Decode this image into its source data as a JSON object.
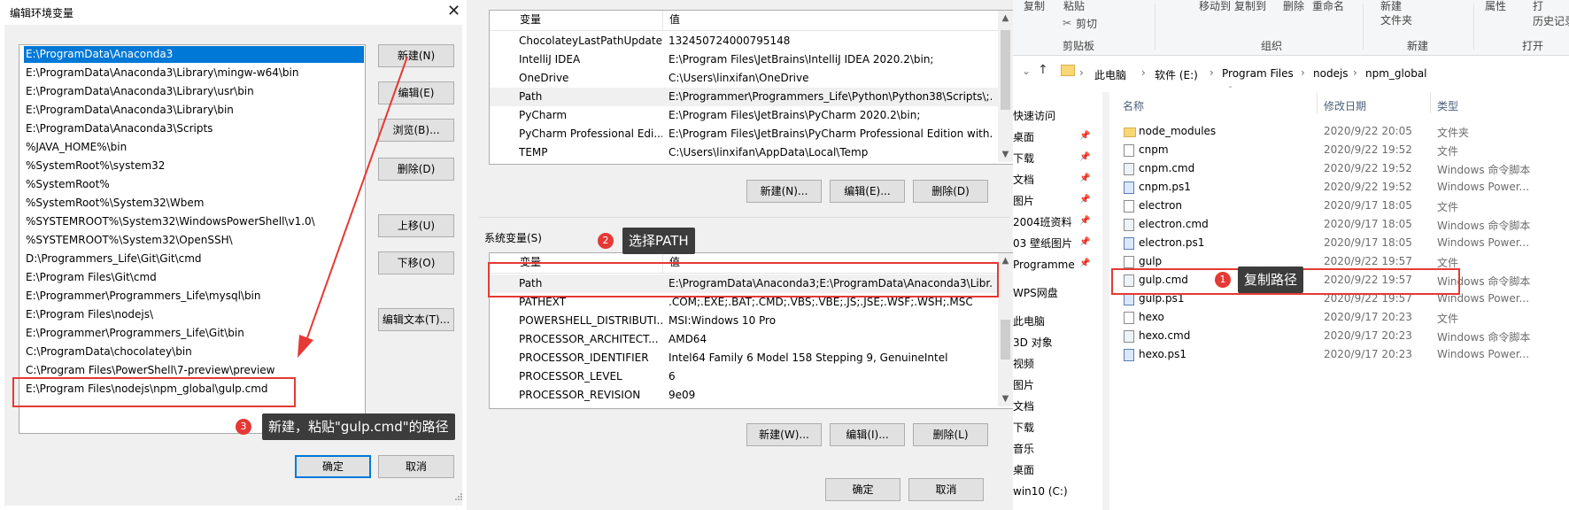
{
  "edit_dialog": {
    "title": "编辑环境变量",
    "close_glyph": "✕",
    "entries": [
      "E:\\ProgramData\\Anaconda3",
      "E:\\ProgramData\\Anaconda3\\Library\\mingw-w64\\bin",
      "E:\\ProgramData\\Anaconda3\\Library\\usr\\bin",
      "E:\\ProgramData\\Anaconda3\\Library\\bin",
      "E:\\ProgramData\\Anaconda3\\Scripts",
      "%JAVA_HOME%\\bin",
      "%SystemRoot%\\system32",
      "%SystemRoot%",
      "%SystemRoot%\\System32\\Wbem",
      "%SYSTEMROOT%\\System32\\WindowsPowerShell\\v1.0\\",
      "%SYSTEMROOT%\\System32\\OpenSSH\\",
      "D:\\Programmers_Life\\Git\\Git\\cmd",
      "E:\\Program Files\\Git\\cmd",
      "E:\\Programmer\\Programmers_Life\\mysql\\bin",
      "E:\\Program Files\\nodejs\\",
      "E:\\Programmer\\Programmers_Life\\Git\\bin",
      "C:\\ProgramData\\chocolatey\\bin",
      "C:\\Program Files\\PowerShell\\7-preview\\preview",
      "E:\\Program Files\\nodejs\\npm_global\\gulp.cmd"
    ],
    "buttons": {
      "new": "新建(N)",
      "edit": "编辑(E)",
      "browse": "浏览(B)...",
      "delete": "删除(D)",
      "move_up": "上移(U)",
      "move_down": "下移(O)",
      "edit_text": "编辑文本(T)...",
      "ok": "确定",
      "cancel": "取消"
    },
    "callout": {
      "number": "3",
      "text": "新建，粘贴\"gulp.cmd\"的路径"
    }
  },
  "env_dialog": {
    "user_vars": {
      "headers": {
        "name": "变量",
        "value": "值"
      },
      "rows": [
        {
          "name": "ChocolateyLastPathUpdate",
          "value": "132450724000795148"
        },
        {
          "name": "IntelliJ IDEA",
          "value": "E:\\Program Files\\JetBrains\\IntelliJ IDEA 2020.2\\bin;"
        },
        {
          "name": "OneDrive",
          "value": "C:\\Users\\linxifan\\OneDrive"
        },
        {
          "name": "Path",
          "value": "E:\\Programmer\\Programmers_Life\\Python\\Python38\\Scripts\\;..."
        },
        {
          "name": "PyCharm",
          "value": "E:\\Program Files\\JetBrains\\PyCharm 2020.2\\bin;"
        },
        {
          "name": "PyCharm Professional Edi...",
          "value": "E:\\Program Files\\JetBrains\\PyCharm Professional Edition with..."
        },
        {
          "name": "TEMP",
          "value": "C:\\Users\\linxifan\\AppData\\Local\\Temp"
        }
      ],
      "buttons": {
        "new": "新建(N)...",
        "edit": "编辑(E)...",
        "delete": "删除(D)"
      }
    },
    "system_label": "系统变量(S)",
    "system_vars": {
      "headers": {
        "name": "变量",
        "value": "值"
      },
      "rows": [
        {
          "name": "Path",
          "value": "E:\\ProgramData\\Anaconda3;E:\\ProgramData\\Anaconda3\\Libr..."
        },
        {
          "name": "PATHEXT",
          "value": ".COM;.EXE;.BAT;.CMD;.VBS;.VBE;.JS;.JSE;.WSF;.WSH;.MSC"
        },
        {
          "name": "POWERSHELL_DISTRIBUTI...",
          "value": "MSI:Windows 10 Pro"
        },
        {
          "name": "PROCESSOR_ARCHITECT...",
          "value": "AMD64"
        },
        {
          "name": "PROCESSOR_IDENTIFIER",
          "value": "Intel64 Family 6 Model 158 Stepping 9, GenuineIntel"
        },
        {
          "name": "PROCESSOR_LEVEL",
          "value": "6"
        },
        {
          "name": "PROCESSOR_REVISION",
          "value": "9e09"
        }
      ],
      "buttons": {
        "new": "新建(W)...",
        "edit": "编辑(I)...",
        "delete": "删除(L)"
      }
    },
    "buttons": {
      "ok": "确定",
      "cancel": "取消"
    },
    "callout": {
      "number": "2",
      "text": "选择PATH"
    }
  },
  "explorer": {
    "ribbon": {
      "copy": "复制",
      "paste": "粘贴",
      "cut": "剪切",
      "clipboard_group": "剪贴板",
      "move_to": "移动到",
      "copy_to": "复制到",
      "delete": "删除",
      "rename": "重命名",
      "organize_group": "组织",
      "new_item": "新建",
      "new_folder": "文件夹",
      "new_group": "新建",
      "properties": "属性",
      "open_group": "打开",
      "history": "历史记录",
      "open_trunc": "打"
    },
    "breadcrumbs": [
      "此电脑",
      "软件 (E:)",
      "Program Files",
      "nodejs",
      "npm_global"
    ],
    "nav": [
      {
        "label": "快速访问",
        "pinned": false
      },
      {
        "label": "桌面",
        "pinned": true
      },
      {
        "label": "下载",
        "pinned": true
      },
      {
        "label": "文档",
        "pinned": true
      },
      {
        "label": "图片",
        "pinned": true
      },
      {
        "label": "2004班资料",
        "pinned": true
      },
      {
        "label": "03 壁纸图片",
        "pinned": true
      },
      {
        "label": "Programme",
        "pinned": true
      },
      {
        "label": "WPS网盘",
        "pinned": false
      },
      {
        "label": "此电脑",
        "pinned": false
      },
      {
        "label": "3D 对象",
        "pinned": false
      },
      {
        "label": "视频",
        "pinned": false
      },
      {
        "label": "图片",
        "pinned": false
      },
      {
        "label": "文档",
        "pinned": false
      },
      {
        "label": "下载",
        "pinned": false
      },
      {
        "label": "音乐",
        "pinned": false
      },
      {
        "label": "桌面",
        "pinned": false
      },
      {
        "label": "win10 (C:)",
        "pinned": false
      }
    ],
    "columns": {
      "name": "名称",
      "date": "修改日期",
      "type": "类型"
    },
    "files": [
      {
        "name": "node_modules",
        "date": "2020/9/22 20:05",
        "type": "文件夹",
        "icon": "folder-icon"
      },
      {
        "name": "cnpm",
        "date": "2020/9/22 19:52",
        "type": "文件",
        "icon": "file-icon"
      },
      {
        "name": "cnpm.cmd",
        "date": "2020/9/22 19:52",
        "type": "Windows 命令脚本",
        "icon": "cmd-file-icon"
      },
      {
        "name": "cnpm.ps1",
        "date": "2020/9/22 19:52",
        "type": "Windows Power...",
        "icon": "ps1-file-icon"
      },
      {
        "name": "electron",
        "date": "2020/9/17 18:05",
        "type": "文件",
        "icon": "file-icon"
      },
      {
        "name": "electron.cmd",
        "date": "2020/9/17 18:05",
        "type": "Windows 命令脚本",
        "icon": "cmd-file-icon"
      },
      {
        "name": "electron.ps1",
        "date": "2020/9/17 18:05",
        "type": "Windows Power...",
        "icon": "ps1-file-icon"
      },
      {
        "name": "gulp",
        "date": "2020/9/22 19:57",
        "type": "文件",
        "icon": "file-icon"
      },
      {
        "name": "gulp.cmd",
        "date": "2020/9/22 19:57",
        "type": "Windows 命令脚本",
        "icon": "cmd-file-icon"
      },
      {
        "name": "gulp.ps1",
        "date": "2020/9/22 19:57",
        "type": "Windows Power...",
        "icon": "ps1-file-icon"
      },
      {
        "name": "hexo",
        "date": "2020/9/17 20:23",
        "type": "文件",
        "icon": "file-icon"
      },
      {
        "name": "hexo.cmd",
        "date": "2020/9/17 20:23",
        "type": "Windows 命令脚本",
        "icon": "cmd-file-icon"
      },
      {
        "name": "hexo.ps1",
        "date": "2020/9/17 20:23",
        "type": "Windows Power...",
        "icon": "ps1-file-icon"
      }
    ],
    "callout": {
      "number": "1",
      "text": "复制路径"
    }
  },
  "colors": {
    "selection": "#0078d7",
    "annotation_red": "#e53935",
    "callout_bg": "#3c3c3c"
  }
}
